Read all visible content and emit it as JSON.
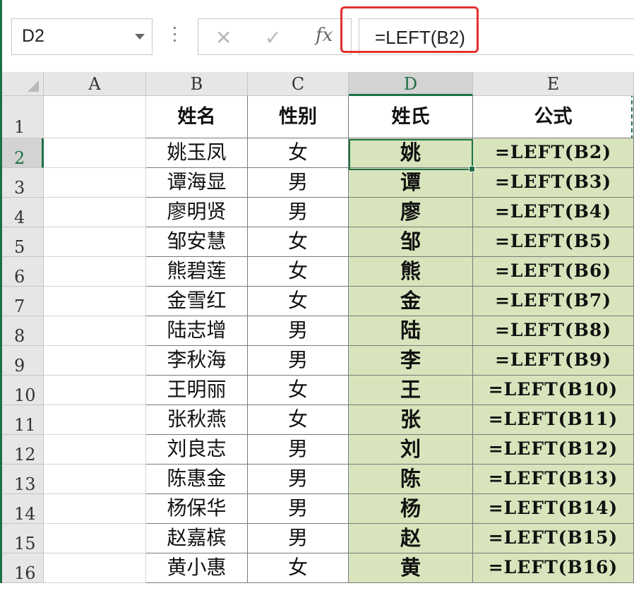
{
  "formula_bar": {
    "name_box": "D2",
    "cancel_icon": "✕",
    "enter_icon": "✓",
    "fx_label": "fx",
    "formula": "=LEFT(B2)"
  },
  "columns": [
    "A",
    "B",
    "C",
    "D",
    "E"
  ],
  "selected_column": "D",
  "selected_row": "2",
  "headers": {
    "name": "姓名",
    "gender": "性别",
    "surname": "姓氏",
    "formula": "公式"
  },
  "rows": [
    {
      "row": "2",
      "name": "姚玉凤",
      "gender": "女",
      "surname": "姚",
      "formula": "=LEFT(B2)"
    },
    {
      "row": "3",
      "name": "谭海显",
      "gender": "男",
      "surname": "谭",
      "formula": "=LEFT(B3)"
    },
    {
      "row": "4",
      "name": "廖明贤",
      "gender": "男",
      "surname": "廖",
      "formula": "=LEFT(B4)"
    },
    {
      "row": "5",
      "name": "邹安慧",
      "gender": "女",
      "surname": "邹",
      "formula": "=LEFT(B5)"
    },
    {
      "row": "6",
      "name": "熊碧莲",
      "gender": "女",
      "surname": "熊",
      "formula": "=LEFT(B6)"
    },
    {
      "row": "7",
      "name": "金雪红",
      "gender": "女",
      "surname": "金",
      "formula": "=LEFT(B7)"
    },
    {
      "row": "8",
      "name": "陆志增",
      "gender": "男",
      "surname": "陆",
      "formula": "=LEFT(B8)"
    },
    {
      "row": "9",
      "name": "李秋海",
      "gender": "男",
      "surname": "李",
      "formula": "=LEFT(B9)"
    },
    {
      "row": "10",
      "name": "王明丽",
      "gender": "女",
      "surname": "王",
      "formula": "=LEFT(B10)"
    },
    {
      "row": "11",
      "name": "张秋燕",
      "gender": "女",
      "surname": "张",
      "formula": "=LEFT(B11)"
    },
    {
      "row": "12",
      "name": "刘良志",
      "gender": "男",
      "surname": "刘",
      "formula": "=LEFT(B12)"
    },
    {
      "row": "13",
      "name": "陈惠金",
      "gender": "男",
      "surname": "陈",
      "formula": "=LEFT(B13)"
    },
    {
      "row": "14",
      "name": "杨保华",
      "gender": "男",
      "surname": "杨",
      "formula": "=LEFT(B14)"
    },
    {
      "row": "15",
      "name": "赵嘉槟",
      "gender": "男",
      "surname": "赵",
      "formula": "=LEFT(B15)"
    },
    {
      "row": "16",
      "name": "黄小惠",
      "gender": "女",
      "surname": "黄",
      "formula": "=LEFT(B16)"
    }
  ],
  "header_row": "1",
  "accent_color": "#1e7145",
  "highlight_color": "#e3312d",
  "fill_color": "#d8e4bc"
}
